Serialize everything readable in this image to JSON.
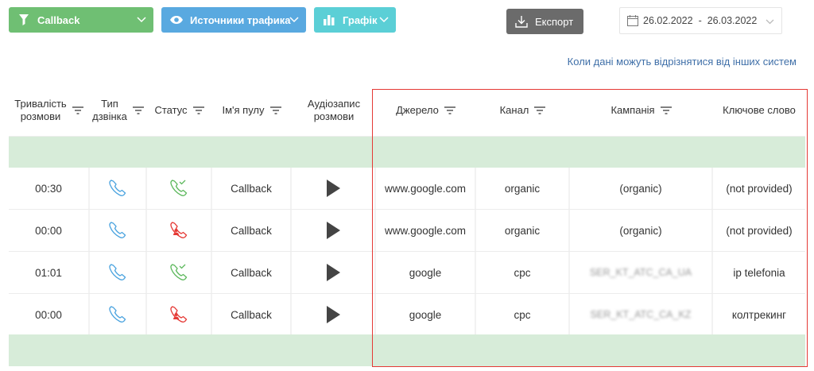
{
  "toolbar": {
    "callback_label": "Callback",
    "traffic_label": "Источники трафика",
    "chart_label": "Графік",
    "export_label": "Експорт"
  },
  "date_range": {
    "start": "26.02.2022",
    "separator": "-",
    "end": "26.03.2022"
  },
  "note_link": "Коли дані можуть відрізнятися від інших систем",
  "columns": [
    {
      "line1": "Тривалість",
      "line2": "розмови",
      "filter": true
    },
    {
      "line1": "Тип",
      "line2": "дзвінка",
      "filter": true
    },
    {
      "line1": "Статус",
      "line2": "",
      "filter": true
    },
    {
      "line1": "Ім'я пулу",
      "line2": "",
      "filter": true
    },
    {
      "line1": "Аудіозапис",
      "line2": "розмови",
      "filter": false
    },
    {
      "line1": "Джерело",
      "line2": "",
      "filter": true
    },
    {
      "line1": "Канал",
      "line2": "",
      "filter": true
    },
    {
      "line1": "Кампанія",
      "line2": "",
      "filter": true
    },
    {
      "line1": "Ключове слово",
      "line2": "",
      "filter": false
    }
  ],
  "rows": [
    {
      "duration": "00:30",
      "call_type": "callback",
      "status": "answered",
      "pool": "Callback",
      "source": "www.google.com",
      "channel": "organic",
      "campaign": "(organic)",
      "keyword": "(not provided)"
    },
    {
      "duration": "00:00",
      "call_type": "callback",
      "status": "missed",
      "pool": "Callback",
      "source": "www.google.com",
      "channel": "organic",
      "campaign": "(organic)",
      "keyword": "(not provided)"
    },
    {
      "duration": "01:01",
      "call_type": "callback",
      "status": "answered",
      "pool": "Callback",
      "source": "google",
      "channel": "cpc",
      "campaign": "SER_KT_ATC_CA_UA",
      "keyword": "ip telefonia"
    },
    {
      "duration": "00:00",
      "call_type": "callback",
      "status": "missed",
      "pool": "Callback",
      "source": "google",
      "channel": "cpc",
      "campaign": "SER_KT_ATC_CA_KZ",
      "keyword": "колтрекинг"
    }
  ],
  "colors": {
    "callback": "#6fbf73",
    "traffic": "#59a9e0",
    "chart": "#5bcfd6",
    "export": "#6b6b6b",
    "band": "#d7ecd9",
    "highlight": "#e53935",
    "link": "#3f6fa8"
  }
}
